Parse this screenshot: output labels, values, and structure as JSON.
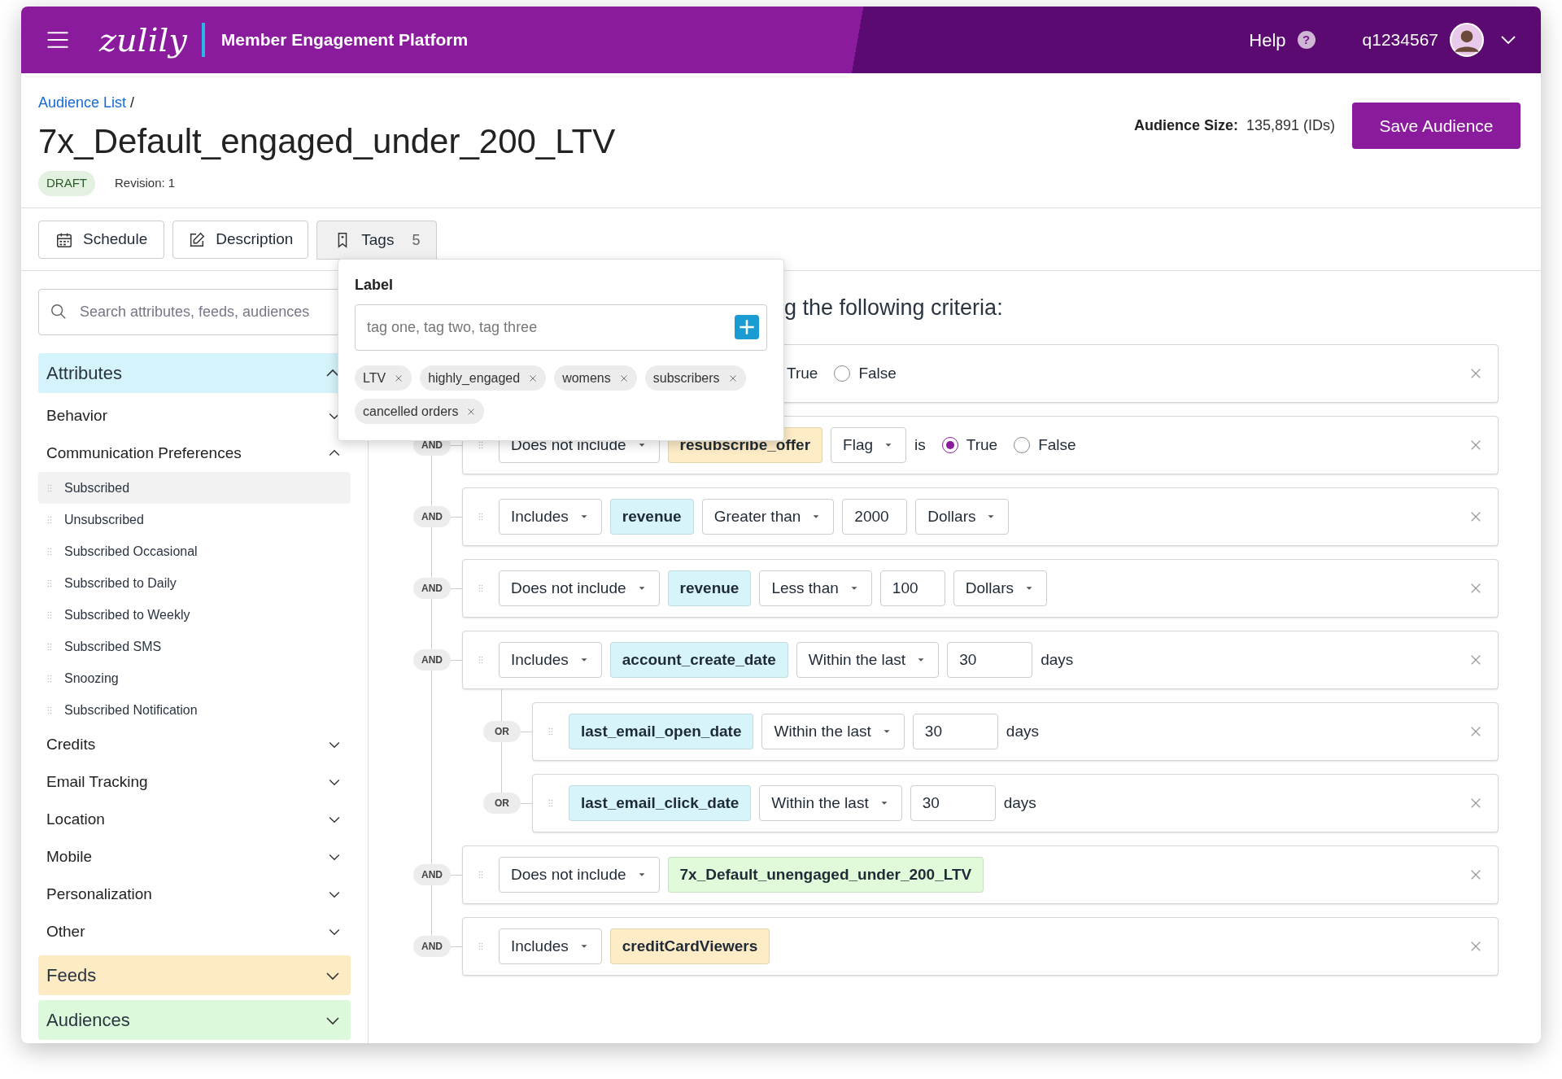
{
  "header": {
    "logo": "zulily",
    "app_title": "Member Engagement Platform",
    "help": "Help",
    "help_glyph": "?",
    "user": "q1234567"
  },
  "breadcrumb": {
    "link": "Audience List",
    "separator": "/"
  },
  "title": "7x_Default_engaged_under_200_LTV",
  "status_badge": "DRAFT",
  "revision": "Revision: 1",
  "audience_size": {
    "label": "Audience Size:",
    "value": "135,891 (IDs)"
  },
  "save_button": "Save Audience",
  "toolbar": [
    {
      "label": "Schedule",
      "selected": false
    },
    {
      "label": "Description",
      "selected": false
    },
    {
      "label": "Tags",
      "count": "5",
      "selected": true
    }
  ],
  "tags_popover": {
    "label": "Label",
    "input": {
      "placeholder": "tag one, tag two, tag three"
    },
    "tags": [
      "LTV",
      "highly_engaged",
      "womens",
      "subscribers",
      "cancelled orders"
    ]
  },
  "sidebar": {
    "search": {
      "placeholder": "Search attributes, feeds, audiences"
    },
    "sections": [
      {
        "label": "Attributes",
        "kind": "attributes",
        "expanded": true,
        "groups": [
          {
            "label": "Behavior",
            "expanded": false
          },
          {
            "label": "Communication Preferences",
            "expanded": true,
            "items": [
              {
                "label": "Subscribed",
                "selected": true
              },
              {
                "label": "Unsubscribed",
                "selected": false
              },
              {
                "label": "Subscribed Occasional",
                "selected": false
              },
              {
                "label": "Subscribed to Daily",
                "selected": false
              },
              {
                "label": "Subscribed to Weekly",
                "selected": false
              },
              {
                "label": "Subscribed SMS",
                "selected": false
              },
              {
                "label": "Snoozing",
                "selected": false
              },
              {
                "label": "Subscribed Notification",
                "selected": false
              }
            ]
          },
          {
            "label": "Credits",
            "expanded": false
          },
          {
            "label": "Email Tracking",
            "expanded": false
          },
          {
            "label": "Location",
            "expanded": false
          },
          {
            "label": "Mobile",
            "expanded": false
          },
          {
            "label": "Personalization",
            "expanded": false
          },
          {
            "label": "Other",
            "expanded": false
          }
        ]
      },
      {
        "label": "Feeds",
        "kind": "feeds",
        "expanded": false
      },
      {
        "label": "Audiences",
        "kind": "audiences",
        "expanded": false
      }
    ]
  },
  "criteria": {
    "heading": "g the following criteria:",
    "rows": [
      {
        "parts": [
          {
            "kind": "text",
            "value": "True"
          },
          {
            "kind": "radio",
            "label": "False",
            "selected": false
          }
        ]
      },
      {
        "connector": "AND",
        "parts": [
          {
            "kind": "select",
            "value": "Does not include"
          },
          {
            "kind": "field",
            "color": "#fdecc6",
            "value": "resubscribe_offer"
          },
          {
            "kind": "select",
            "value": "Flag"
          },
          {
            "kind": "text",
            "value": "is"
          },
          {
            "kind": "radio",
            "label": "True",
            "selected": true
          },
          {
            "kind": "radio",
            "label": "False",
            "selected": false
          }
        ]
      },
      {
        "connector": "AND",
        "parts": [
          {
            "kind": "select",
            "value": "Includes"
          },
          {
            "kind": "field",
            "color": "#d7f4fb",
            "value": "revenue"
          },
          {
            "kind": "select",
            "value": "Greater than"
          },
          {
            "kind": "input",
            "value": "2000"
          },
          {
            "kind": "select",
            "value": "Dollars"
          }
        ]
      },
      {
        "connector": "AND",
        "parts": [
          {
            "kind": "select",
            "value": "Does not include"
          },
          {
            "kind": "field",
            "color": "#d7f4fb",
            "value": "revenue"
          },
          {
            "kind": "select",
            "value": "Less than"
          },
          {
            "kind": "input",
            "value": "100"
          },
          {
            "kind": "select",
            "value": "Dollars"
          }
        ]
      },
      {
        "connector": "AND",
        "parts": [
          {
            "kind": "select",
            "value": "Includes"
          },
          {
            "kind": "field",
            "color": "#d7f4fb",
            "value": "account_create_date"
          },
          {
            "kind": "select",
            "value": "Within the last"
          },
          {
            "kind": "input",
            "value": "30"
          },
          {
            "kind": "text",
            "value": "days"
          }
        ],
        "children": [
          {
            "connector": "OR",
            "parts": [
              {
                "kind": "field",
                "color": "#d7f4fb",
                "value": "last_email_open_date"
              },
              {
                "kind": "select",
                "value": "Within the last"
              },
              {
                "kind": "input",
                "value": "30"
              },
              {
                "kind": "text",
                "value": "days"
              }
            ]
          },
          {
            "connector": "OR",
            "parts": [
              {
                "kind": "field",
                "color": "#d7f4fb",
                "value": "last_email_click_date"
              },
              {
                "kind": "select",
                "value": "Within the last"
              },
              {
                "kind": "input",
                "value": "30"
              },
              {
                "kind": "text",
                "value": "days"
              }
            ]
          }
        ]
      },
      {
        "connector": "AND",
        "parts": [
          {
            "kind": "select",
            "value": "Does not include"
          },
          {
            "kind": "field",
            "color": "#e1fbda",
            "value": "7x_Default_unengaged_under_200_LTV"
          }
        ]
      },
      {
        "connector": "AND",
        "parts": [
          {
            "kind": "select",
            "value": "Includes"
          },
          {
            "kind": "field",
            "color": "#fdecc6",
            "value": "creditCardViewers"
          }
        ]
      }
    ]
  }
}
